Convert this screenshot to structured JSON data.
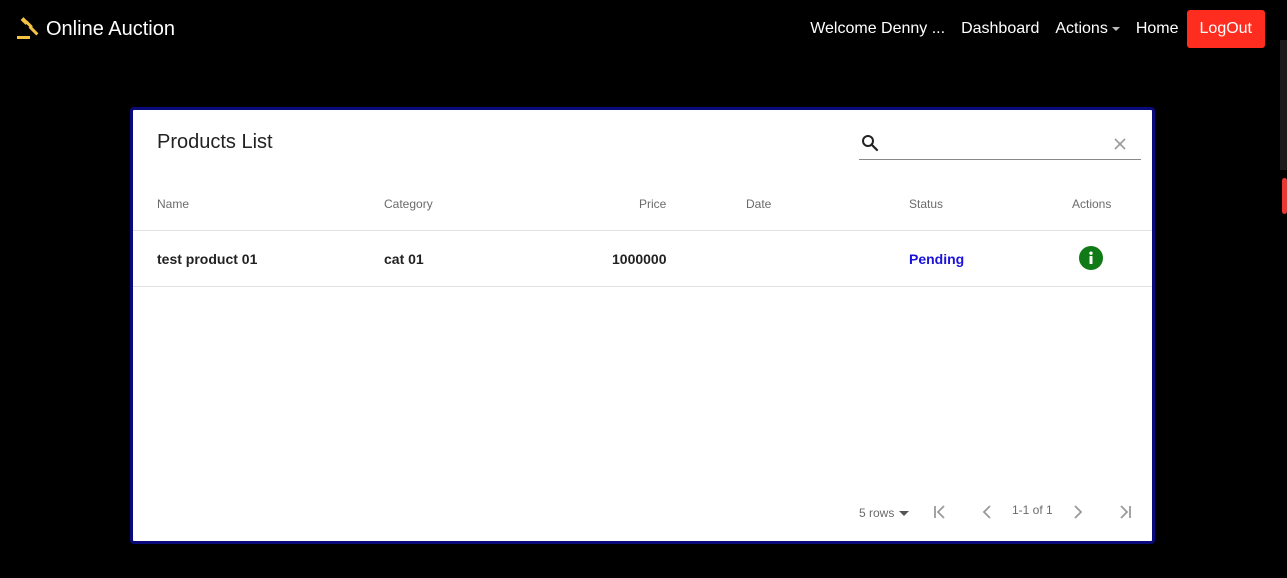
{
  "navbar": {
    "brand": "Online Auction",
    "welcome": "Welcome Denny ...",
    "dashboard": "Dashboard",
    "actions": "Actions",
    "home": "Home",
    "logout": "LogOut"
  },
  "colors": {
    "brand_icon": "#f5c341",
    "logout_bg": "#ff2d20",
    "card_border": "#0a0a7a",
    "status_pending": "#1a12d8",
    "info_icon_bg": "#0f7a16"
  },
  "products": {
    "title": "Products List",
    "search": {
      "value": "",
      "placeholder": ""
    },
    "columns": [
      "Name",
      "Category",
      "Price",
      "Date",
      "Status",
      "Actions"
    ],
    "rows": [
      {
        "name": "test product 01",
        "category": "cat 01",
        "price": "1000000",
        "date": "",
        "status": "Pending",
        "action_icon": "info-icon"
      }
    ],
    "pagination": {
      "rows_per_page": "5 rows",
      "range": "1-1 of 1"
    }
  }
}
